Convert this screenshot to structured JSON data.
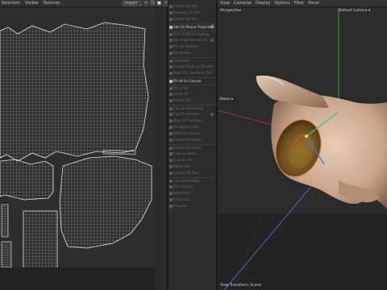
{
  "uv_editor": {
    "menu": [
      "Selection",
      "Visible",
      "Textures"
    ],
    "dropdown": "Project",
    "buttons": [
      "+",
      "❐",
      "■",
      "↑",
      "↗",
      "☰"
    ]
  },
  "tools": {
    "items": [
      {
        "label": "Create UV Set",
        "style": "dim"
      },
      {
        "label": "Rename UV Set",
        "style": "dim"
      },
      {
        "label": "Delete UV Set",
        "style": "dim"
      },
      {
        "label": "Set UV Planar Projection",
        "style": "bright",
        "sep": true,
        "gear": true
      },
      {
        "label": "Set LSCM UV Unwrap",
        "style": "dim",
        "sep": true
      },
      {
        "label": "Set Angle Based UV",
        "style": "dim",
        "dot": true
      },
      {
        "label": "Pin UV Vertices",
        "style": "dim"
      },
      {
        "label": "Pin Border",
        "style": "dim"
      },
      {
        "label": "UV Shells",
        "style": "dim",
        "sep": true
      },
      {
        "label": "Unfold Shells to Bounds",
        "style": "dim"
      },
      {
        "label": "Pack UV Islands to Tile",
        "style": "dim"
      },
      {
        "label": "Fit UV to Canvas",
        "style": "bright",
        "sep": true
      },
      {
        "label": "Move UV",
        "style": "dim",
        "sep": true
      },
      {
        "label": "Scale UV",
        "style": "dim"
      },
      {
        "label": "Rotate UV",
        "style": "dim"
      },
      {
        "label": "Flip UV Horizontal",
        "style": "dim",
        "sep": true
      },
      {
        "label": "Flip UV Vertical",
        "style": "dim",
        "dot": true
      },
      {
        "label": "Align UV Vertical",
        "style": "dim"
      },
      {
        "label": "Straighten UVs",
        "style": "dim"
      },
      {
        "label": "Weld UV Seams",
        "style": "dim"
      },
      {
        "label": "Create UV Seam",
        "style": "dim"
      },
      {
        "label": "Delete UV Seam",
        "style": "dim",
        "sep": true
      },
      {
        "label": "Loop to Seam",
        "style": "dim"
      },
      {
        "label": "Unwrap UV",
        "style": "dim"
      },
      {
        "label": "Stitch UVs",
        "style": "dim"
      },
      {
        "label": "Layout UV Tiles",
        "style": "dim"
      },
      {
        "label": "Cut Seam Edge",
        "style": "dim",
        "sep": true
      },
      {
        "label": "UV Checker",
        "style": "dim"
      },
      {
        "label": "Normalize",
        "style": "dim"
      },
      {
        "label": "Relax UVs",
        "style": "dim"
      },
      {
        "label": "Preview",
        "style": "dim"
      }
    ]
  },
  "viewport": {
    "menu": [
      "View",
      "Cameras",
      "Display",
      "Options",
      "Filter",
      "Panel"
    ],
    "perspective_label": "Perspective",
    "camera_label": "Default Camera ▾",
    "view_label": "Vbase ▸",
    "footer_label": "View Transform: Scene"
  },
  "colors": {
    "background": "#2b2b2b",
    "uv_wire": "#d9d9d9",
    "axis_red": "#c23a3a",
    "axis_green": "#3ec85e",
    "axis_blue": "#3a7bd5",
    "model_skin": "#c9a48a"
  }
}
